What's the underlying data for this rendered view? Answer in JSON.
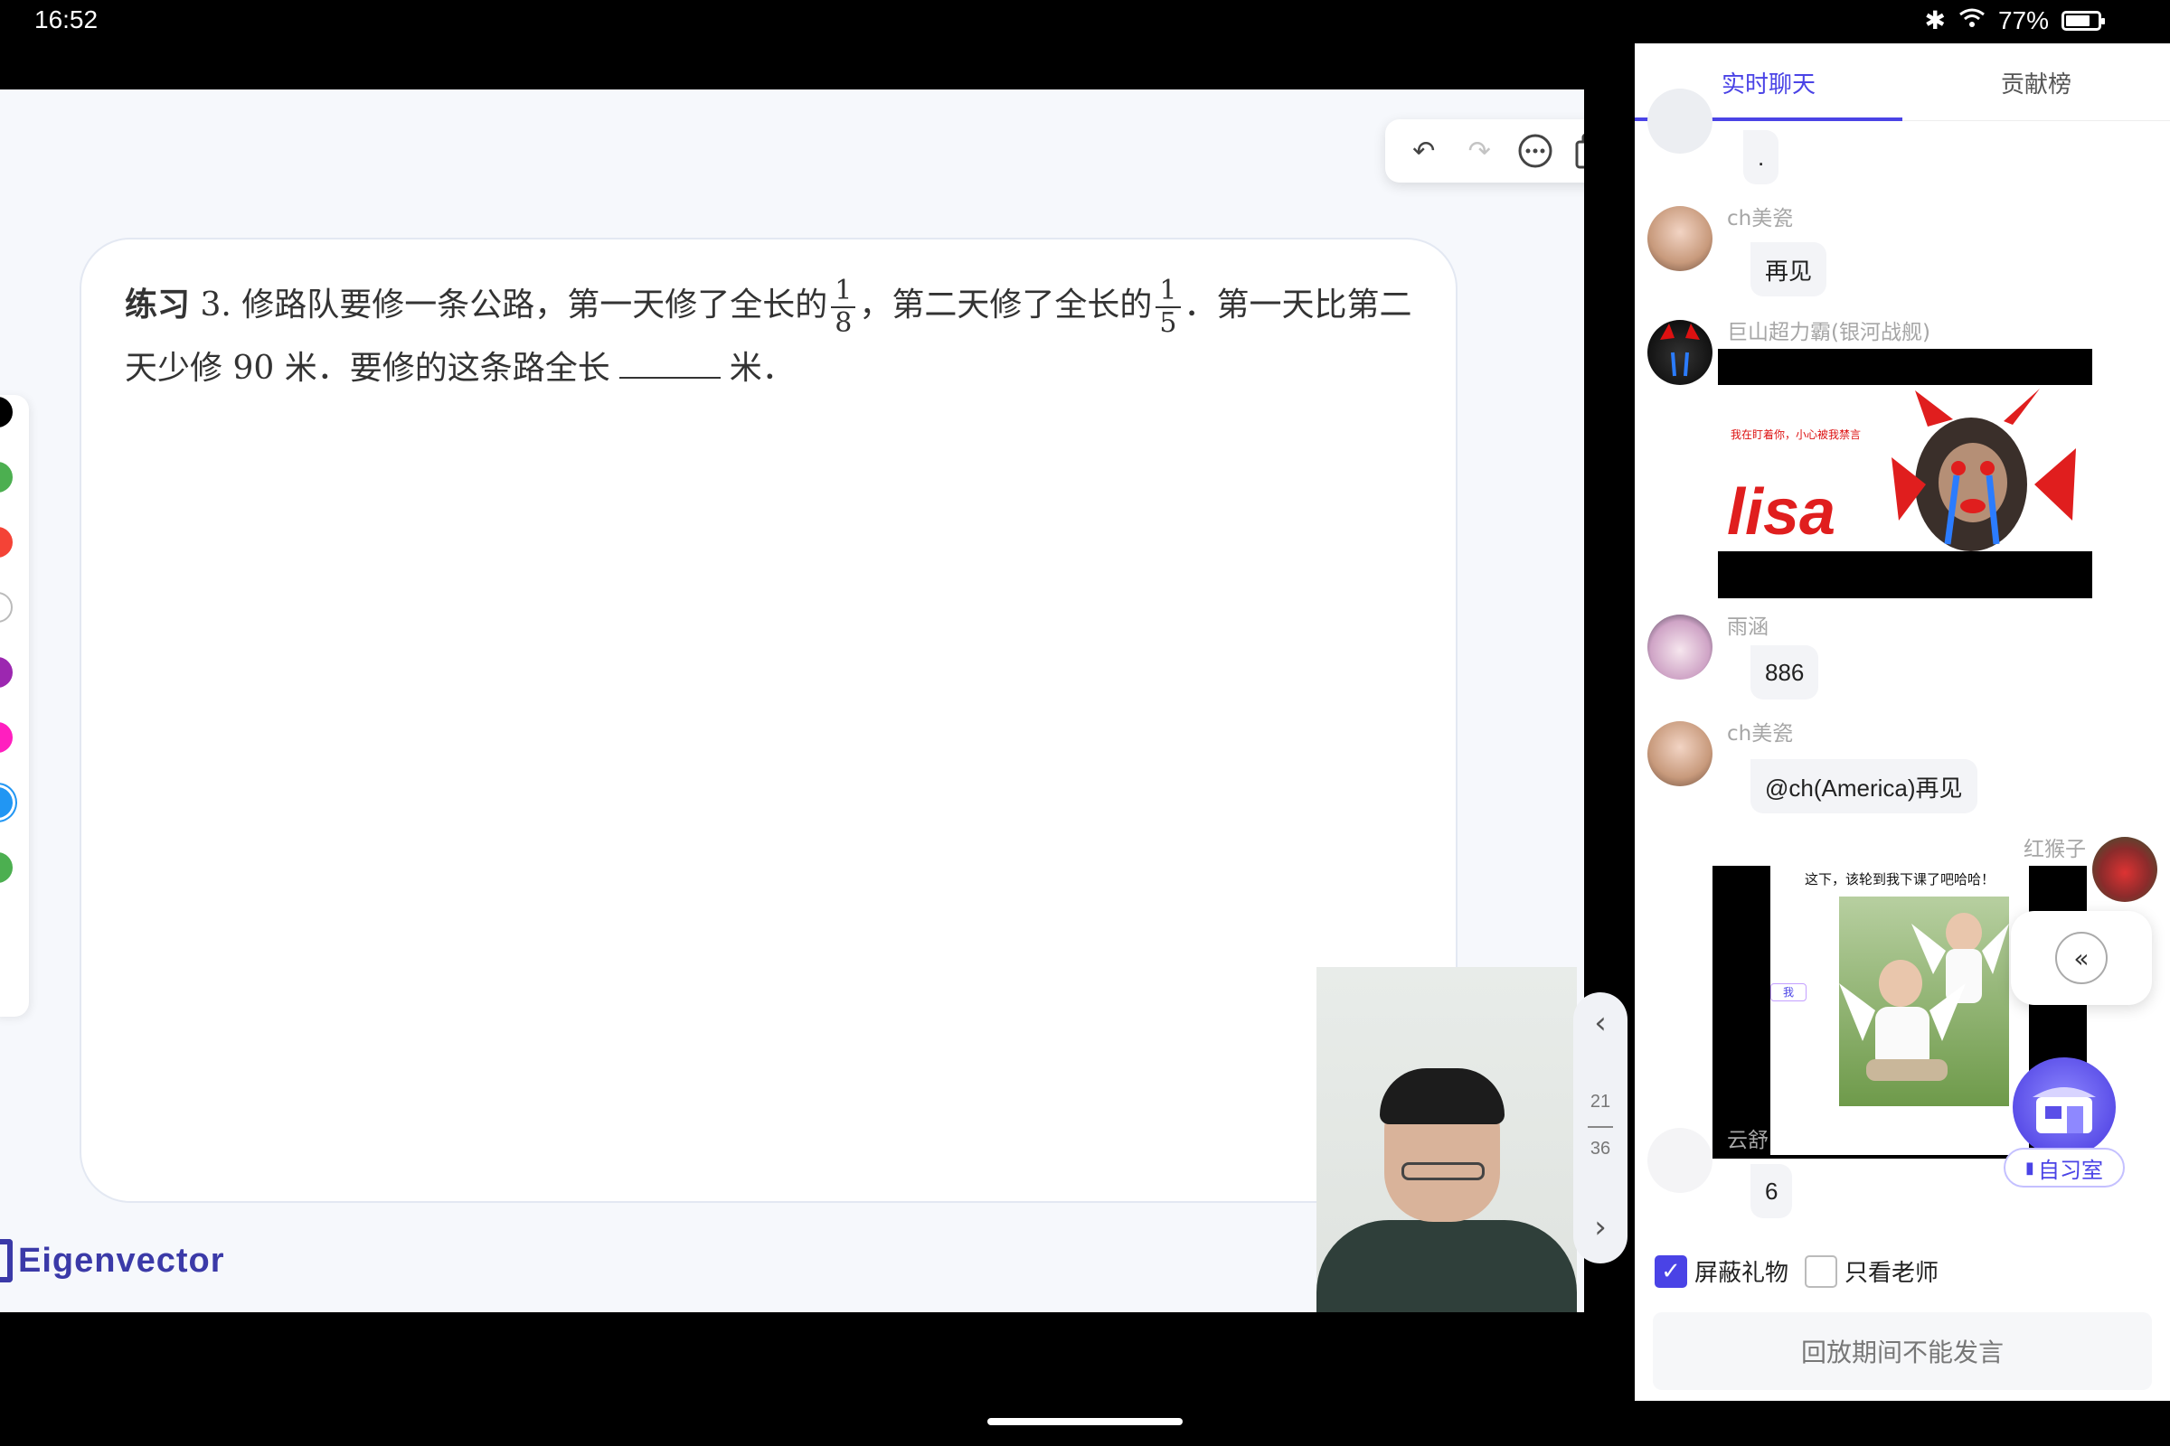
{
  "status_bar": {
    "time": "16:52",
    "battery": "77%",
    "battery_fraction": 0.77
  },
  "board": {
    "question": {
      "label": "练习",
      "number": "3.",
      "part1": "修路队要修一条公路，第一天修了全长的",
      "frac1_num": "1",
      "frac1_den": "8",
      "part2": "，第二天修了全长的",
      "frac2_num": "1",
      "frac2_den": "5",
      "part3": "．第一天比第二天少修 90 米．要修的这条路全长",
      "part4": "米．"
    },
    "toolbar": {
      "undo_icon": "undo-icon",
      "redo_icon": "redo-icon",
      "more_icon": "more-icon",
      "copy_icon": "copy-icon"
    },
    "colors": [
      "#000000",
      "#4caf50",
      "#f44336",
      "#ffffff",
      "#9c27b0",
      "#ff1fbf",
      "#2196f3",
      "#4caf50"
    ],
    "logo_text": "Eigenvector",
    "pager": {
      "current": "21",
      "total": "36"
    }
  },
  "chat": {
    "tabs": [
      {
        "label": "实时聊天",
        "active": true
      },
      {
        "label": "贡献榜",
        "active": false
      }
    ],
    "messages": [
      {
        "text": "."
      },
      {
        "name": "ch美瓷",
        "text": "再见"
      },
      {
        "name": "巨山超力霸(银河战舰)",
        "image_caption": "我在盯着你，小心被我禁言",
        "image_word": "lisa"
      },
      {
        "name": "雨涵",
        "text": "886"
      },
      {
        "name": "ch美瓷",
        "text": "@ch(America)再见"
      },
      {
        "name": "红猴子",
        "image_caption": "这下，该轮到我下课了吧哈哈！",
        "image_tag": "我"
      },
      {
        "name": "云舒",
        "text": "6"
      }
    ],
    "controls": {
      "block_gifts": "屏蔽礼物",
      "block_gifts_checked": true,
      "teacher_only": "只看老师",
      "teacher_only_checked": false,
      "input_placeholder": "回放期间不能发言"
    },
    "study_room": "自习室",
    "accent": "#4a43e6"
  }
}
